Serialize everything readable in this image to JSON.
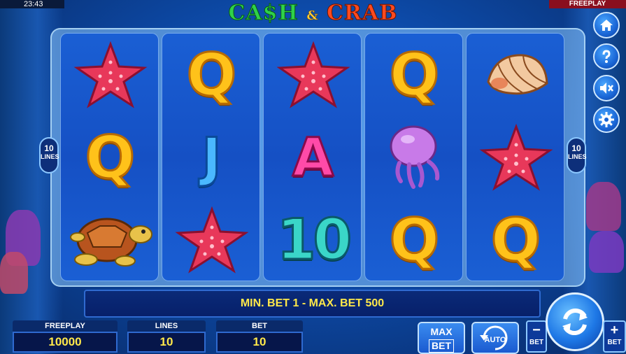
{
  "status": {
    "clock": "23:43",
    "mode_tag": "FREEPLAY"
  },
  "logo": {
    "part1": "CA$H",
    "amp": "&",
    "part2": "CRAB"
  },
  "reels": [
    [
      "starfish",
      "Q",
      "turtle"
    ],
    [
      "Q",
      "J",
      "starfish"
    ],
    [
      "starfish",
      "A",
      "10"
    ],
    [
      "Q",
      "jellyfish",
      "Q"
    ],
    [
      "shell",
      "starfish",
      "Q"
    ]
  ],
  "lines_badge": {
    "number": "10",
    "label": "LINES"
  },
  "message": "MIN. BET 1 - MAX. BET 500",
  "panels": {
    "balance": {
      "label": "FREEPLAY",
      "value": "10000"
    },
    "lines": {
      "label": "LINES",
      "value": "10"
    },
    "bet": {
      "label": "BET",
      "value": "10"
    }
  },
  "buttons": {
    "max_bet_line1": "MAX",
    "max_bet_line2": "BET",
    "auto": "AUTO",
    "bet_minus_symbol": "−",
    "bet_minus_label": "BET",
    "bet_plus_symbol": "+",
    "bet_plus_label": "BET"
  },
  "side_icons": [
    "home-icon",
    "help-icon",
    "sound-muted-icon",
    "settings-icon"
  ],
  "colors": {
    "accent_text": "#ffe84a",
    "panel_bg": "#06164a",
    "brand_green": "#2fd14a",
    "brand_red": "#ff4a1e"
  }
}
